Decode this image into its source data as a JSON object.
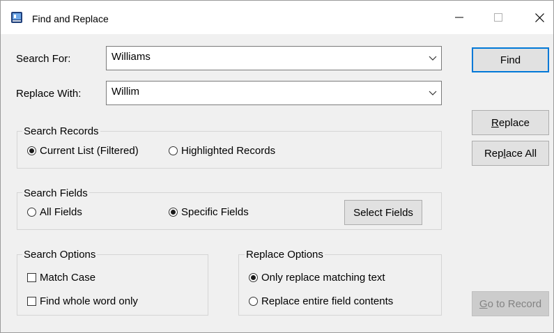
{
  "window": {
    "title": "Find and Replace",
    "controls": {
      "minimize": "—",
      "maximize": "☐",
      "close": "✕"
    }
  },
  "search_for": {
    "label": "Search For:",
    "value": "Williams"
  },
  "replace_with": {
    "label": "Replace With:",
    "value": "Willim"
  },
  "search_records": {
    "title": "Search Records",
    "options": [
      {
        "label": "Current List (Filtered)",
        "selected": true
      },
      {
        "label": "Highlighted Records",
        "selected": false
      }
    ]
  },
  "search_fields": {
    "title": "Search Fields",
    "options": [
      {
        "label": "All Fields",
        "selected": false
      },
      {
        "label": "Specific Fields",
        "selected": true
      }
    ],
    "select_button": "Select Fields"
  },
  "search_options": {
    "title": "Search Options",
    "checks": [
      {
        "label": "Match Case",
        "checked": false
      },
      {
        "label": "Find whole word only",
        "checked": false
      }
    ]
  },
  "replace_options": {
    "title": "Replace Options",
    "options": [
      {
        "label": "Only replace matching text",
        "selected": true
      },
      {
        "label": "Replace entire field contents",
        "selected": false
      }
    ]
  },
  "buttons": {
    "find": "Find",
    "replace_pre": "",
    "replace_key": "R",
    "replace_post": "eplace",
    "replace_all_pre": "Rep",
    "replace_all_key": "l",
    "replace_all_post": "ace All",
    "goto_pre": "",
    "goto_key": "G",
    "goto_post": "o to Record"
  },
  "colors": {
    "accent": "#0078d7",
    "background": "#f0f0f0",
    "disabled_text": "#838383"
  }
}
